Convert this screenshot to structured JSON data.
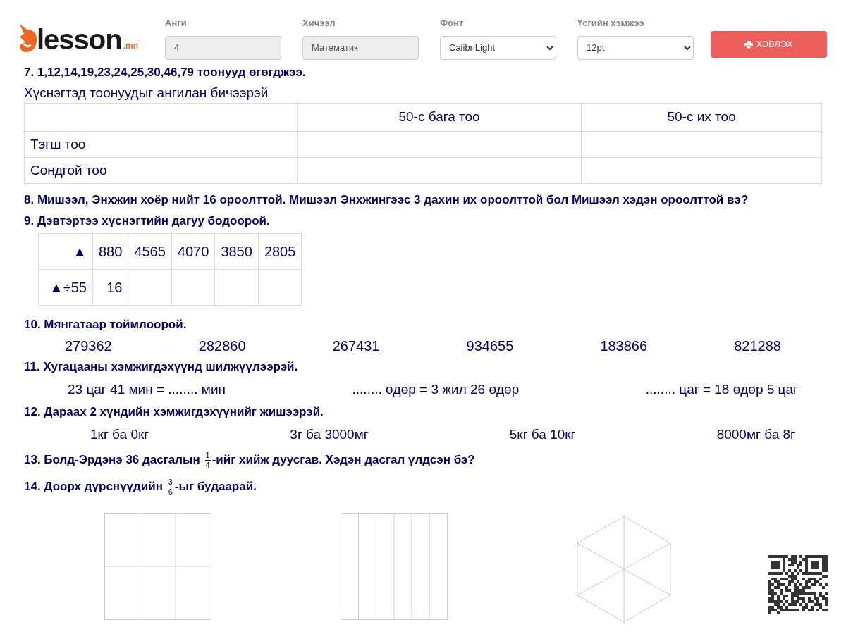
{
  "header": {
    "logo": {
      "name": "lesson",
      "suffix": ".mn"
    },
    "fields": [
      {
        "label": "Анги",
        "kind": "input",
        "value": "4"
      },
      {
        "label": "Хичээл",
        "kind": "input",
        "value": "Математик"
      },
      {
        "label": "Фонт",
        "kind": "select",
        "value": "CalibriLight"
      },
      {
        "label": "Үсгийн хэмжээ",
        "kind": "select",
        "value": "12pt"
      }
    ],
    "print_button": "ХЭВЛЭХ"
  },
  "q7": {
    "title": "7. 1,12,14,19,23,24,25,30,46,79 тоонууд өгөгджээ.",
    "instruction": "Хүснэгтэд тоонуудыг ангилан бичээрэй",
    "columns": [
      "50-с бага тоо",
      "50-с их тоо"
    ],
    "rows": [
      "Тэгш тоо",
      "Сондгой тоо"
    ]
  },
  "q8": {
    "title": "8. Мишээл, Энхжин хоёр нийт 16 ороолттой. Мишээл Энхжингээс 3 дахин их ороолттой бол Мишээл хэдэн ороолттой вэ?"
  },
  "q9": {
    "title": "9. Дэвтэртээ хүснэгтийн дагуу бодоорой.",
    "rows": [
      [
        "▲",
        "880",
        "4565",
        "4070",
        "3850",
        "2805"
      ],
      [
        "▲÷55",
        "16"
      ]
    ]
  },
  "q10": {
    "title": "10. Мянгатаар тоймлоорой.",
    "items": [
      "279362",
      "282860",
      "267431",
      "934655",
      "183866",
      "821288"
    ]
  },
  "q11": {
    "title": "11. Хугацааны хэмжигдэхүүнд шилжүүлээрэй.",
    "items": [
      "23 цаг 41 мин = ........ мин",
      "........ өдөр = 3 жил 26 өдөр",
      "........ цаг = 18 өдөр 5 цаг"
    ]
  },
  "q12": {
    "title": "12. Дараах 2 хүндийн хэмжигдэхүүнийг жишээрэй.",
    "items": [
      "1кг ба 0кг",
      "3г ба 3000мг",
      "5кг ба 10кг",
      "8000мг ба 8г"
    ]
  },
  "q13": {
    "before": "13. Болд-Эрдэнэ 36 дасгалын",
    "numerator": "1",
    "denominator": "4",
    "after": "-ийг хийж дуусгав. Хэдэн дасгал үлдсэн бэ?"
  },
  "q14": {
    "before": "14. Доорх дүрснүүдийн",
    "numerator": "3",
    "denominator": "6",
    "after": "-ыг будаарай.",
    "shapes": [
      {
        "kind": "grid"
      },
      {
        "kind": "strips"
      },
      {
        "kind": "hexagon"
      }
    ]
  }
}
